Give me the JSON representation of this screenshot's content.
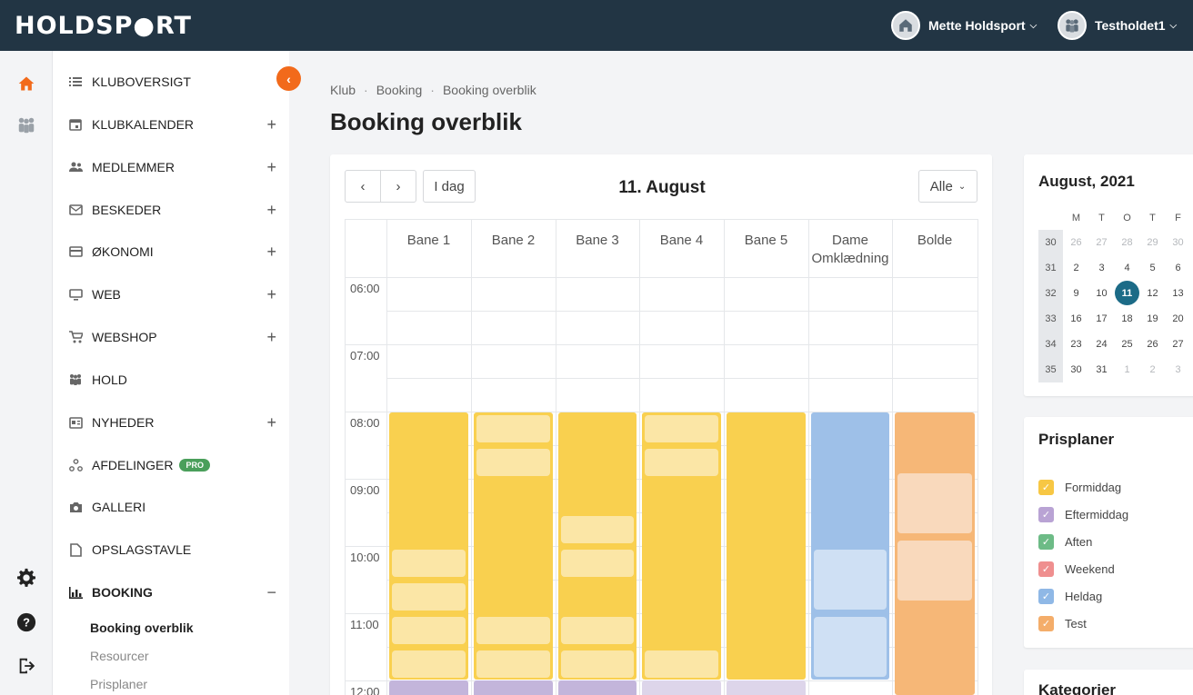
{
  "app": {
    "logo": "HOLDSP●RT",
    "user_name": "Mette Holdsport",
    "team_name": "Testholdet1"
  },
  "sidebar": {
    "items": [
      {
        "label": "KLUBOVERSIGT",
        "icon": "list-icon",
        "expandable": false
      },
      {
        "label": "KLUBKALENDER",
        "icon": "calendar-icon",
        "expandable": true
      },
      {
        "label": "MEDLEMMER",
        "icon": "members-icon",
        "expandable": true
      },
      {
        "label": "BESKEDER",
        "icon": "mail-icon",
        "expandable": true
      },
      {
        "label": "ØKONOMI",
        "icon": "credit-card-icon",
        "expandable": true
      },
      {
        "label": "WEB",
        "icon": "monitor-icon",
        "expandable": true
      },
      {
        "label": "WEBSHOP",
        "icon": "cart-icon",
        "expandable": true
      },
      {
        "label": "HOLD",
        "icon": "team-icon",
        "expandable": false
      },
      {
        "label": "NYHEDER",
        "icon": "news-icon",
        "expandable": true
      },
      {
        "label": "AFDELINGER",
        "icon": "departments-icon",
        "expandable": false,
        "badge": "PRO"
      },
      {
        "label": "GALLERI",
        "icon": "camera-icon",
        "expandable": false
      },
      {
        "label": "OPSLAGSTAVLE",
        "icon": "document-icon",
        "expandable": false
      },
      {
        "label": "BOOKING",
        "icon": "bar-chart-icon",
        "expandable": true,
        "expanded": true
      }
    ],
    "plus": "+",
    "minus": "−",
    "subitems": [
      "Booking overblik",
      "Resourcer",
      "Prisplaner"
    ]
  },
  "breadcrumb": [
    "Klub",
    "Booking",
    "Booking overblik"
  ],
  "page_title": "Booking overblik",
  "toolbar": {
    "prev": "‹",
    "next": "›",
    "today": "I dag",
    "date": "11. August",
    "filter": "Alle"
  },
  "schedule": {
    "columns": [
      "Bane 1",
      "Bane 2",
      "Bane 3",
      "Bane 4",
      "Bane 5",
      "Dame Omklædning",
      "Bolde"
    ],
    "times": [
      "06:00",
      "07:00",
      "08:00",
      "09:00",
      "10:00",
      "11:00",
      "12:00"
    ]
  },
  "calendar": {
    "title": "August, 2021",
    "headers": [
      "M",
      "T",
      "O",
      "T",
      "F"
    ],
    "weeks": [
      {
        "wk": "30",
        "days": [
          "26",
          "27",
          "28",
          "29",
          "30"
        ],
        "muted": [
          true,
          true,
          true,
          true,
          true
        ]
      },
      {
        "wk": "31",
        "days": [
          "2",
          "3",
          "4",
          "5",
          "6"
        ],
        "muted": [
          false,
          false,
          false,
          false,
          false
        ]
      },
      {
        "wk": "32",
        "days": [
          "9",
          "10",
          "11",
          "12",
          "13"
        ],
        "muted": [
          false,
          false,
          false,
          false,
          false
        ]
      },
      {
        "wk": "33",
        "days": [
          "16",
          "17",
          "18",
          "19",
          "20"
        ],
        "muted": [
          false,
          false,
          false,
          false,
          false
        ]
      },
      {
        "wk": "34",
        "days": [
          "23",
          "24",
          "25",
          "26",
          "27"
        ],
        "muted": [
          false,
          false,
          false,
          false,
          false
        ]
      },
      {
        "wk": "35",
        "days": [
          "30",
          "31",
          "1",
          "2",
          "3"
        ],
        "muted": [
          false,
          false,
          true,
          true,
          true
        ]
      }
    ],
    "selected": "11"
  },
  "prisplaner": {
    "title": "Prisplaner",
    "items": [
      {
        "label": "Formiddag",
        "color": "#f7c744"
      },
      {
        "label": "Eftermiddag",
        "color": "#b9a3d4"
      },
      {
        "label": "Aften",
        "color": "#6dbb86"
      },
      {
        "label": "Weekend",
        "color": "#ef8f8f"
      },
      {
        "label": "Heldag",
        "color": "#8fb8e6"
      },
      {
        "label": "Test",
        "color": "#f4ad6a"
      }
    ]
  },
  "kategorier": {
    "title": "Kategorier"
  },
  "colors": {
    "yellow": "#f9d04f",
    "yellow_light": "#fbe6a6",
    "purple": "#c3b5db",
    "purple_light": "#ddd5ea",
    "blue": "#9ec0e8",
    "blue_light": "#cfe0f4",
    "orange": "#f6b777",
    "orange_light": "#f9d9bc",
    "accent": "#f26a1b",
    "topbar": "#223544"
  }
}
